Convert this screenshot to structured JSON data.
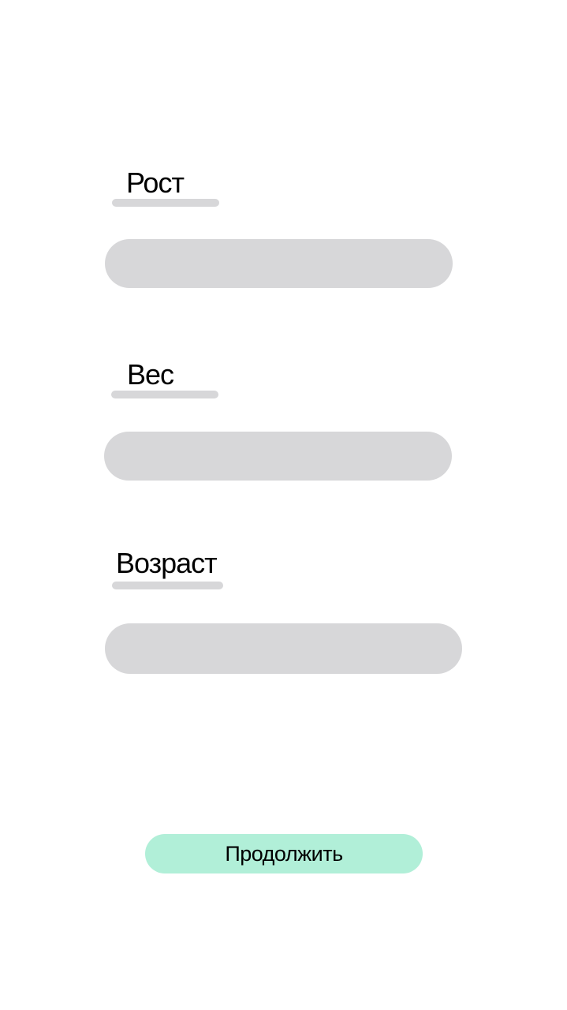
{
  "form": {
    "fields": [
      {
        "label": "Рост",
        "value": ""
      },
      {
        "label": "Вес",
        "value": ""
      },
      {
        "label": "Возраст",
        "value": ""
      }
    ]
  },
  "actions": {
    "continue_label": "Продолжить"
  },
  "colors": {
    "field_background": "#d7d7d9",
    "button_background": "#b1efd8",
    "page_background": "#ffffff"
  }
}
